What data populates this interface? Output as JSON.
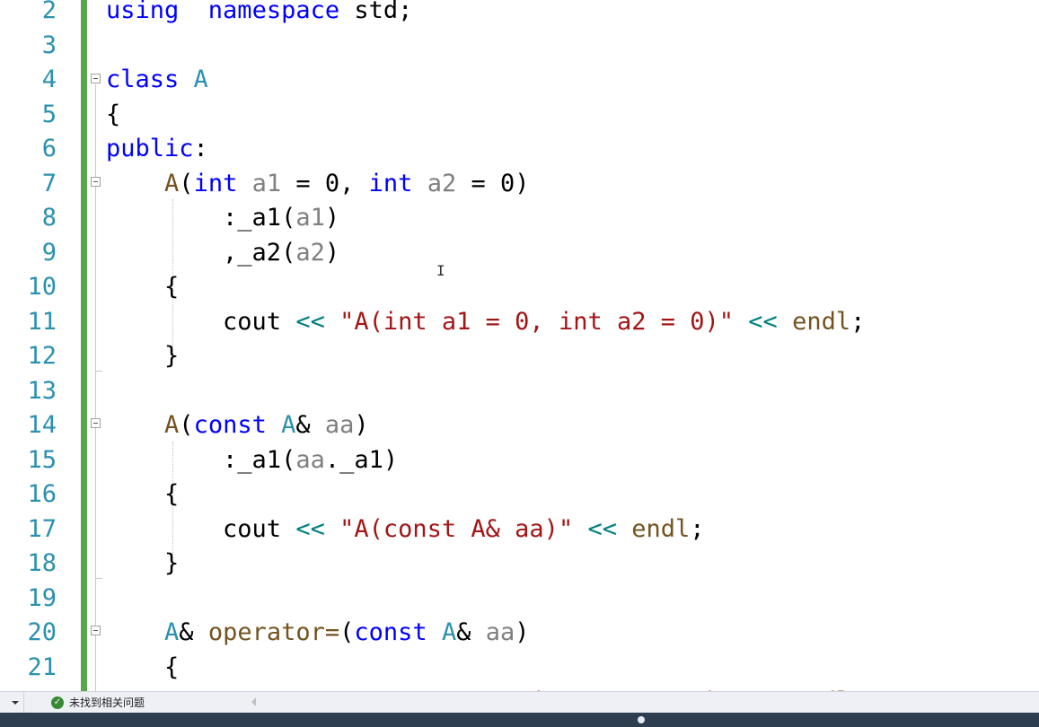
{
  "editor": {
    "lines": [
      {
        "num": "2",
        "tokens": [
          [
            "kw",
            "using"
          ],
          [
            "",
            "  "
          ],
          [
            "kw",
            "namespace"
          ],
          [
            "",
            " std;"
          ]
        ]
      },
      {
        "num": "3",
        "tokens": []
      },
      {
        "num": "4",
        "tokens": [
          [
            "kw",
            "class"
          ],
          [
            "",
            " "
          ],
          [
            "ty",
            "A"
          ]
        ]
      },
      {
        "num": "5",
        "tokens": [
          [
            "",
            "{"
          ]
        ]
      },
      {
        "num": "6",
        "tokens": [
          [
            "kw",
            "public"
          ],
          [
            "",
            ":"
          ]
        ]
      },
      {
        "num": "7",
        "tokens": [
          [
            "",
            "    "
          ],
          [
            "fn",
            "A"
          ],
          [
            "",
            "("
          ],
          [
            "kw",
            "int"
          ],
          [
            "",
            " "
          ],
          [
            "pa",
            "a1"
          ],
          [
            "",
            " = 0, "
          ],
          [
            "kw",
            "int"
          ],
          [
            "",
            " "
          ],
          [
            "pa",
            "a2"
          ],
          [
            "",
            " = 0)"
          ]
        ]
      },
      {
        "num": "8",
        "tokens": [
          [
            "",
            "        :_a1("
          ],
          [
            "pa",
            "a1"
          ],
          [
            "",
            ")"
          ]
        ]
      },
      {
        "num": "9",
        "tokens": [
          [
            "",
            "        ,_a2("
          ],
          [
            "pa",
            "a2"
          ],
          [
            "",
            ")"
          ]
        ]
      },
      {
        "num": "10",
        "tokens": [
          [
            "",
            "    {"
          ]
        ]
      },
      {
        "num": "11",
        "tokens": [
          [
            "",
            "        cout "
          ],
          [
            "op",
            "<<"
          ],
          [
            "",
            " "
          ],
          [
            "st",
            "\"A(int a1 = 0, int a2 = 0)\""
          ],
          [
            "",
            " "
          ],
          [
            "op",
            "<<"
          ],
          [
            "",
            " "
          ],
          [
            "fn",
            "endl"
          ],
          [
            "",
            ";"
          ]
        ]
      },
      {
        "num": "12",
        "tokens": [
          [
            "",
            "    }"
          ]
        ]
      },
      {
        "num": "13",
        "tokens": []
      },
      {
        "num": "14",
        "tokens": [
          [
            "",
            "    "
          ],
          [
            "fn",
            "A"
          ],
          [
            "",
            "("
          ],
          [
            "kw",
            "const"
          ],
          [
            "",
            " "
          ],
          [
            "ty",
            "A"
          ],
          [
            "",
            "& "
          ],
          [
            "pa",
            "aa"
          ],
          [
            "",
            ")"
          ]
        ]
      },
      {
        "num": "15",
        "tokens": [
          [
            "",
            "        :_a1("
          ],
          [
            "pa",
            "aa"
          ],
          [
            "",
            "._a1)"
          ]
        ]
      },
      {
        "num": "16",
        "tokens": [
          [
            "",
            "    {"
          ]
        ]
      },
      {
        "num": "17",
        "tokens": [
          [
            "",
            "        cout "
          ],
          [
            "op",
            "<<"
          ],
          [
            "",
            " "
          ],
          [
            "st",
            "\"A(const A& aa)\""
          ],
          [
            "",
            " "
          ],
          [
            "op",
            "<<"
          ],
          [
            "",
            " "
          ],
          [
            "fn",
            "endl"
          ],
          [
            "",
            ";"
          ]
        ]
      },
      {
        "num": "18",
        "tokens": [
          [
            "",
            "    }"
          ]
        ]
      },
      {
        "num": "19",
        "tokens": []
      },
      {
        "num": "20",
        "tokens": [
          [
            "",
            "    "
          ],
          [
            "ty",
            "A"
          ],
          [
            "",
            "& "
          ],
          [
            "fn",
            "operator="
          ],
          [
            "",
            "("
          ],
          [
            "kw",
            "const"
          ],
          [
            "",
            " "
          ],
          [
            "ty",
            "A"
          ],
          [
            "",
            "& "
          ],
          [
            "pa",
            "aa"
          ],
          [
            "",
            ")"
          ]
        ]
      },
      {
        "num": "21",
        "tokens": [
          [
            "",
            "    {"
          ]
        ]
      },
      {
        "num": "",
        "tokens": [
          [
            "",
            "        cout "
          ],
          [
            "op",
            "<<"
          ],
          [
            "",
            " "
          ],
          [
            "st",
            "\"A& operator=(const A& aa)\""
          ],
          [
            "",
            " "
          ],
          [
            "op",
            "<<"
          ],
          [
            "",
            " "
          ],
          [
            "fn",
            "endl"
          ],
          [
            "",
            ";"
          ]
        ]
      }
    ],
    "caret_glyph": "I"
  },
  "statusbar": {
    "issues_text": "未找到相关问题",
    "ok_icon_glyph": "✓"
  },
  "colors": {
    "keyword": "#0000ff",
    "type": "#2b91af",
    "function": "#74531f",
    "parameter": "#808080",
    "string": "#a31515",
    "operator": "#008080",
    "change_bar": "#57a64a"
  }
}
